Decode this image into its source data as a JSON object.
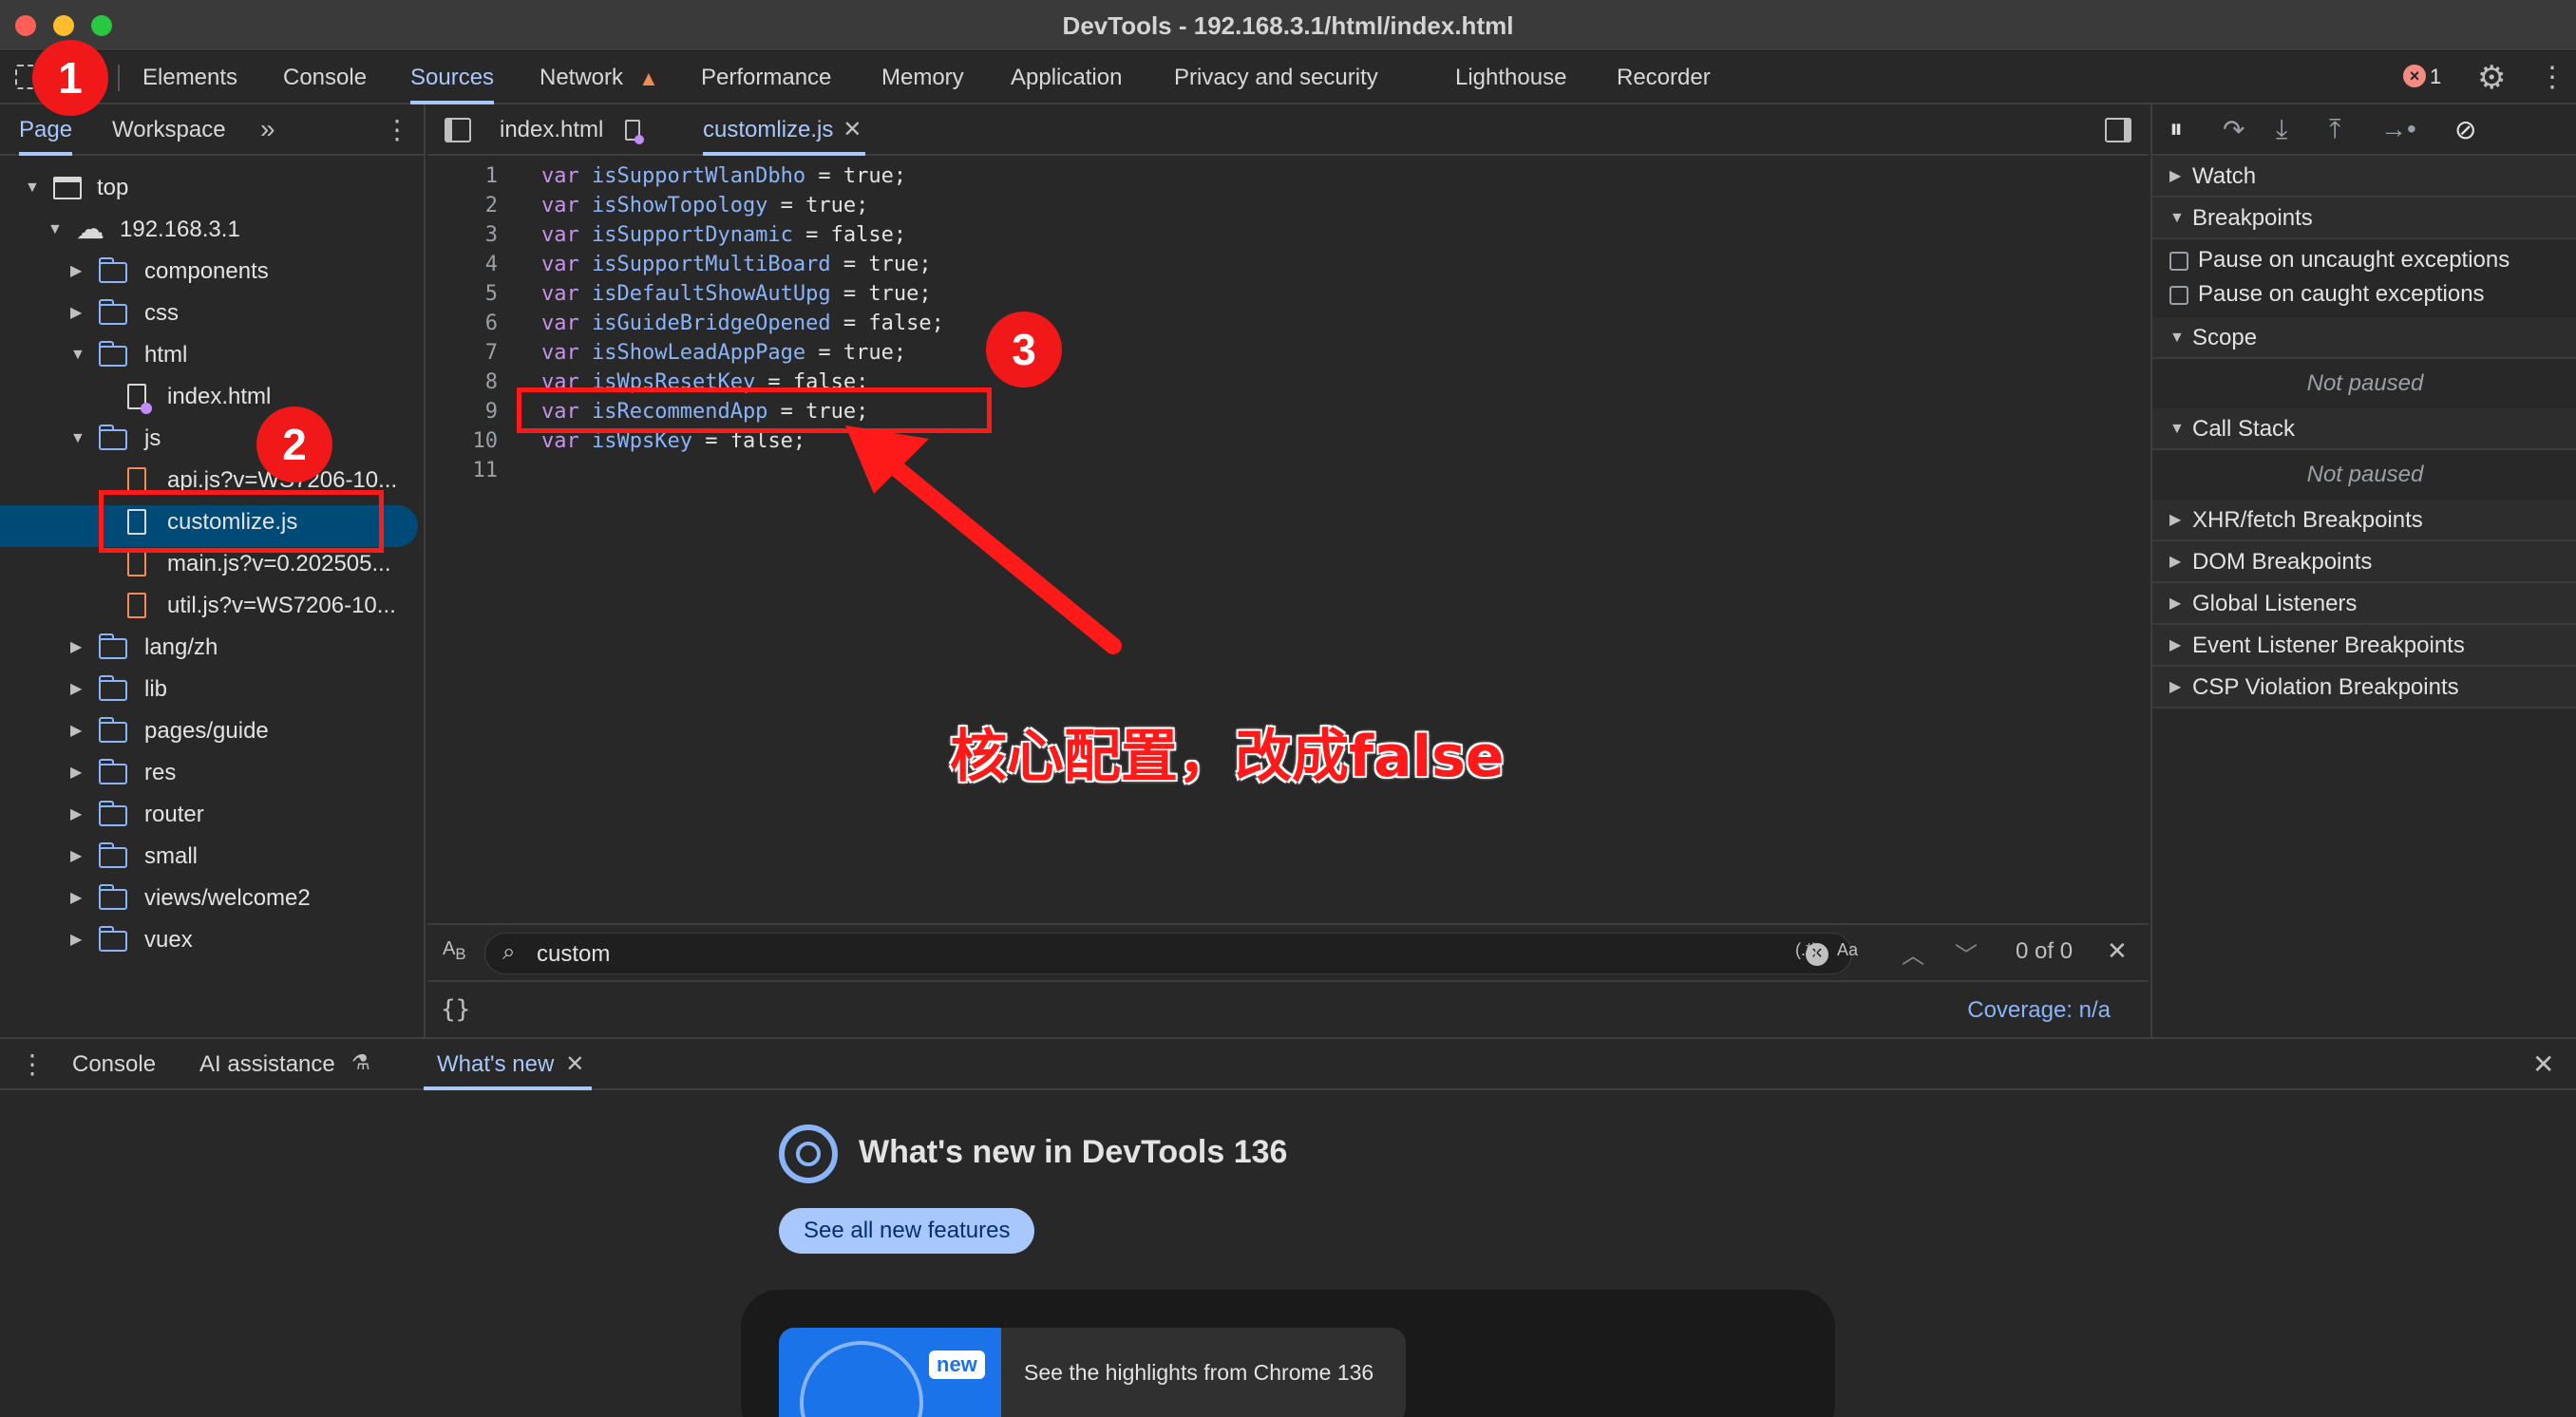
{
  "window": {
    "title": "DevTools - 192.168.3.1/html/index.html"
  },
  "main_tabs": [
    {
      "label": "Elements"
    },
    {
      "label": "Console"
    },
    {
      "label": "Sources"
    },
    {
      "label": "Network"
    },
    {
      "label": "Performance"
    },
    {
      "label": "Memory"
    },
    {
      "label": "Application"
    },
    {
      "label": "Privacy and security"
    },
    {
      "label": "Lighthouse"
    },
    {
      "label": "Recorder"
    }
  ],
  "error_count": "1",
  "navigator": {
    "tabs": [
      {
        "label": "Page"
      },
      {
        "label": "Workspace"
      }
    ],
    "tree": [
      {
        "label": "top"
      },
      {
        "label": "192.168.3.1"
      },
      {
        "label": "components"
      },
      {
        "label": "css"
      },
      {
        "label": "html"
      },
      {
        "label": "index.html"
      },
      {
        "label": "js"
      },
      {
        "label": "api.js?v=WS7206-10..."
      },
      {
        "label": "customlize.js"
      },
      {
        "label": "main.js?v=0.202505..."
      },
      {
        "label": "util.js?v=WS7206-10..."
      },
      {
        "label": "lang/zh"
      },
      {
        "label": "lib"
      },
      {
        "label": "pages/guide"
      },
      {
        "label": "res"
      },
      {
        "label": "router"
      },
      {
        "label": "small"
      },
      {
        "label": "views/welcome2"
      },
      {
        "label": "vuex"
      }
    ]
  },
  "editor": {
    "tabs": [
      {
        "label": "index.html"
      },
      {
        "label": "customlize.js"
      }
    ],
    "lines": [
      {
        "num": "1",
        "kw": "var",
        "name": "isSupportWlanDbho",
        "rest": " = true;"
      },
      {
        "num": "2",
        "kw": "var",
        "name": "isShowTopology",
        "rest": " = true;"
      },
      {
        "num": "3",
        "kw": "var",
        "name": "isSupportDynamic",
        "rest": " = false;"
      },
      {
        "num": "4",
        "kw": "var",
        "name": "isSupportMultiBoard",
        "rest": " = true;"
      },
      {
        "num": "5",
        "kw": "var",
        "name": "isDefaultShowAutUpg",
        "rest": " = true;"
      },
      {
        "num": "6",
        "kw": "var",
        "name": "isGuideBridgeOpened",
        "rest": " = false;"
      },
      {
        "num": "7",
        "kw": "var",
        "name": "isShowLeadAppPage",
        "rest": " = true;"
      },
      {
        "num": "8",
        "kw": "var",
        "name": "isWpsResetKey",
        "rest": " = false;"
      },
      {
        "num": "9",
        "kw": "var",
        "name": "isRecommendApp",
        "rest": " = true;"
      },
      {
        "num": "10",
        "kw": "var",
        "name": "isWpsKey",
        "rest": " = false;"
      },
      {
        "num": "11",
        "kw": "",
        "name": "",
        "rest": ""
      }
    ],
    "search": {
      "value": "custom",
      "regex_label": "(.*)",
      "case_label": "Aa",
      "result": "0 of 0"
    },
    "format_icon": "{}",
    "coverage": "Coverage: n/a"
  },
  "debugger": {
    "sections": {
      "watch": "Watch",
      "breakpoints": "Breakpoints",
      "pause_uncaught": "Pause on uncaught exceptions",
      "pause_caught": "Pause on caught exceptions",
      "scope": "Scope",
      "scope_status": "Not paused",
      "call_stack": "Call Stack",
      "call_stack_status": "Not paused",
      "xhr": "XHR/fetch Breakpoints",
      "dom": "DOM Breakpoints",
      "global": "Global Listeners",
      "event": "Event Listener Breakpoints",
      "csp": "CSP Violation Breakpoints"
    }
  },
  "drawer": {
    "tabs": [
      {
        "label": "Console"
      },
      {
        "label": "AI assistance"
      },
      {
        "label": "What's new"
      }
    ],
    "whats_new": {
      "title": "What's new in DevTools 136",
      "button": "See all new features",
      "card_badge": "new",
      "card_text": "See the highlights from Chrome 136"
    }
  },
  "annotations": {
    "badge1": "1",
    "badge2": "2",
    "badge3": "3",
    "note": "核心配置，改成false"
  },
  "colors": {
    "accent": "#a8c7fa",
    "annotation_red": "#ff1a1a",
    "selected_bg": "#004a77"
  }
}
